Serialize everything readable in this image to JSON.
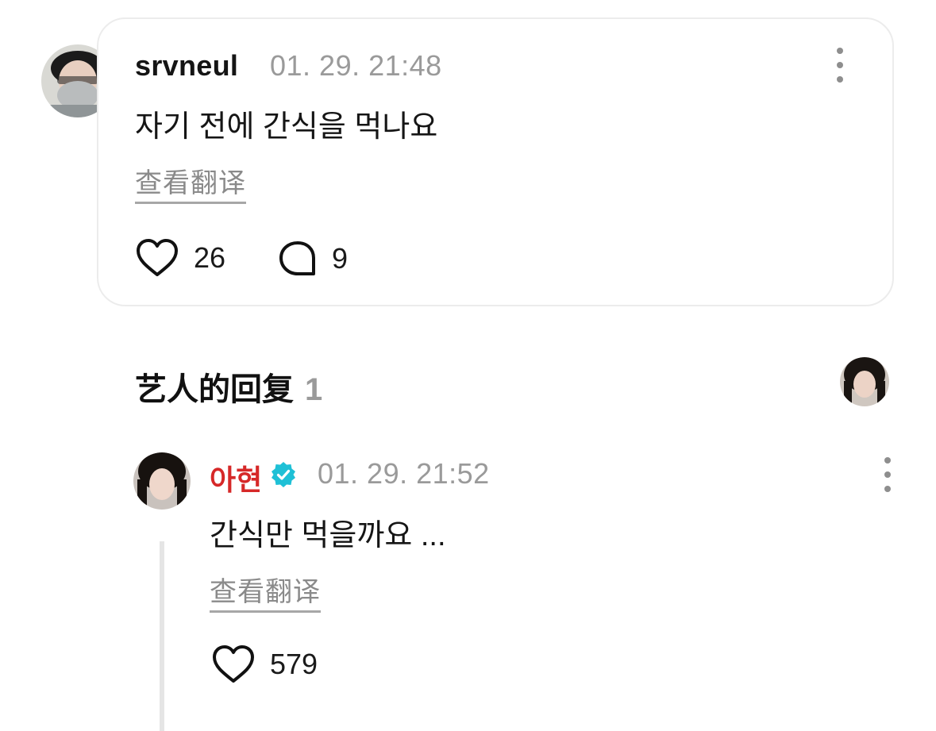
{
  "comment": {
    "username": "srvneul",
    "timestamp": "01. 29. 21:48",
    "text": "자기 전에 간식을 먹나요",
    "translate_label": "查看翻译",
    "likes": "26",
    "replies": "9",
    "avatar_icon": "avatar-masked-person"
  },
  "artist_replies": {
    "title": "艺人的回复",
    "count": "1"
  },
  "reply": {
    "username": "아현",
    "verified_icon": "verified-badge-icon",
    "verified_color": "#1ec0d6",
    "name_color": "#d62828",
    "timestamp": "01. 29. 21:52",
    "text": "간식만 먹을까요 ...",
    "translate_label": "查看翻译",
    "likes": "579"
  }
}
